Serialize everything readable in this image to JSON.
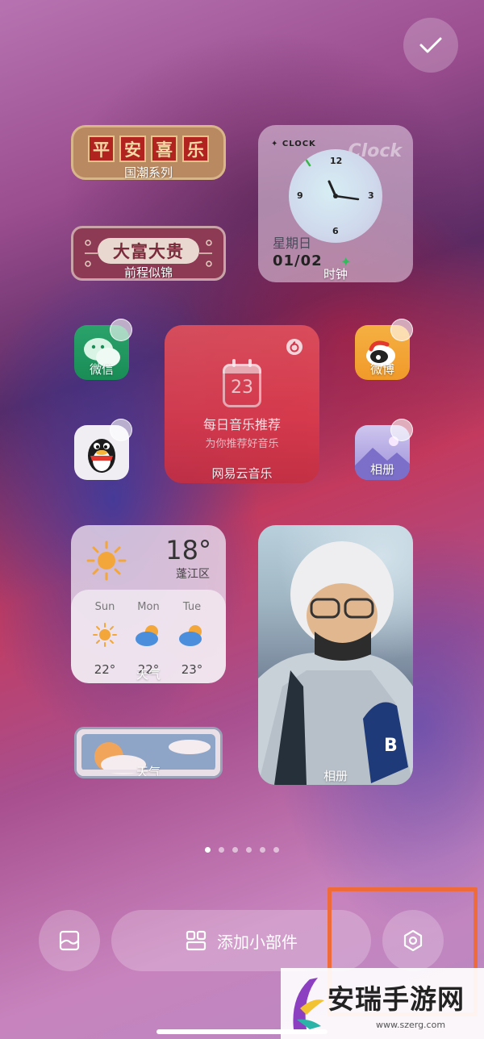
{
  "done_button": {
    "icon": "checkmark-icon"
  },
  "widgets": {
    "pingan": {
      "chars": [
        "平",
        "安",
        "喜",
        "乐"
      ],
      "label": "国潮系列"
    },
    "dafu": {
      "banner": "大富大贵",
      "label": "前程似锦"
    },
    "clock": {
      "brand": "✦ CLOCK",
      "ghost_text": "Clock",
      "numbers": [
        "12",
        "3",
        "6",
        "9"
      ],
      "weekday": "星期日",
      "date": "01/02",
      "label": "时钟"
    },
    "music": {
      "day": "23",
      "title": "每日音乐推荐",
      "subtitle": "为你推荐好音乐",
      "label": "网易云音乐"
    },
    "weather": {
      "temp": "18°",
      "location": "蓬江区",
      "days": [
        {
          "name": "Sun",
          "temp": "22°",
          "icon": "sun-icon"
        },
        {
          "name": "Mon",
          "temp": "22°",
          "icon": "cloud-sun-icon"
        },
        {
          "name": "Tue",
          "temp": "23°",
          "icon": "cloud-sun-icon"
        }
      ],
      "label": "天气"
    },
    "weather_small": {
      "label": "天气"
    },
    "photo": {
      "label": "相册"
    }
  },
  "apps": {
    "wechat": {
      "label": "微信"
    },
    "weibo": {
      "label": "微博"
    },
    "qq": {
      "label": ""
    },
    "gallery": {
      "label": "相册"
    }
  },
  "page_dots": {
    "count": 6,
    "active": 0
  },
  "bottom_bar": {
    "wallpaper_icon": "wallpaper-icon",
    "add_widget_label": "添加小部件",
    "add_widget_icon": "grid-icon",
    "settings_icon": "hexagon-settings-icon"
  },
  "watermark": {
    "text": "安瑞手游网",
    "url": "www.szerg.com"
  },
  "colors": {
    "highlight": "#f06b3a",
    "music_red": "#d93a4b"
  }
}
